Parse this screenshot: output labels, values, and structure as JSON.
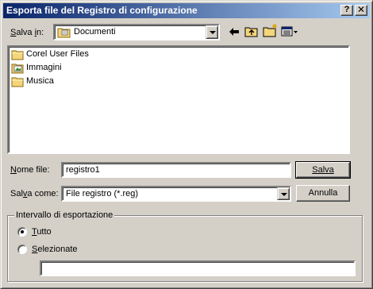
{
  "dialog": {
    "title": "Esporta file del Registro di configurazione",
    "help_label": "?",
    "close_label": "✕"
  },
  "lookin": {
    "label": "Salva in:",
    "value": "Documenti"
  },
  "toolbar": {
    "icons": [
      "back-arrow-icon",
      "up-folder-icon",
      "new-folder-icon",
      "view-menu-icon"
    ]
  },
  "files": [
    {
      "name": "Corel User Files",
      "icon": "folder-icon"
    },
    {
      "name": "Immagini",
      "icon": "pictures-folder-icon"
    },
    {
      "name": "Musica",
      "icon": "folder-icon"
    }
  ],
  "filename": {
    "label": "Nome file:",
    "value": "registro1"
  },
  "filetype": {
    "label": "Salva come:",
    "value": "File registro (*.reg)"
  },
  "buttons": {
    "save": "Salva",
    "cancel": "Annulla"
  },
  "export_range": {
    "title": "Intervallo di esportazione",
    "all_label": "Tutto",
    "selected_label": "Selezionate",
    "selected_value": "",
    "checked": "all"
  }
}
